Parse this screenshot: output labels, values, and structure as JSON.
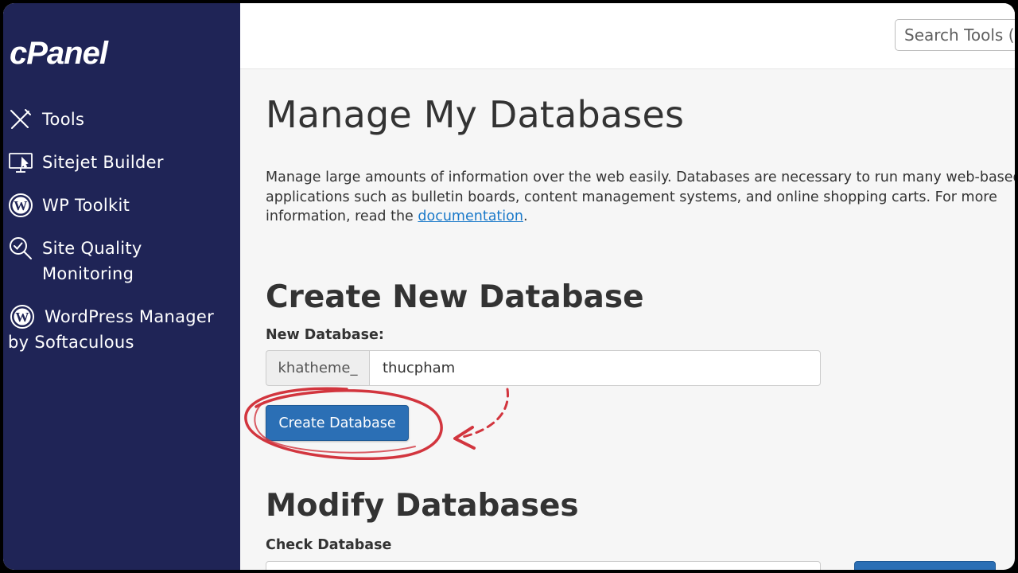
{
  "sidebar": {
    "brand": "cPanel",
    "items": [
      {
        "label": "Tools",
        "icon": "tools-icon"
      },
      {
        "label": "Sitejet Builder",
        "icon": "monitor-icon"
      },
      {
        "label": "WP Toolkit",
        "icon": "wordpress-icon"
      },
      {
        "label": "Site Quality Monitoring",
        "icon": "search-check-icon"
      },
      {
        "label": "WordPress Manager by Softaculous",
        "icon": "wordpress-icon"
      }
    ]
  },
  "topbar": {
    "search_placeholder": "Search Tools ("
  },
  "main": {
    "title": "Manage My Databases",
    "description": "Manage large amounts of information over the web easily. Databases are necessary to run many web-based applications such as bulletin boards, content management systems, and online shopping carts. For more information, read the",
    "description_link": "documentation",
    "description_end": ".",
    "create": {
      "heading": "Create New Database",
      "label": "New Database:",
      "prefix": "khatheme_",
      "value": "thucpham",
      "button": "Create Database"
    },
    "modify": {
      "heading": "Modify Databases",
      "check_label": "Check Database"
    }
  },
  "colors": {
    "sidebar_bg": "#1f2456",
    "primary_button": "#2b6fb5",
    "annotation": "#d2353e",
    "link": "#1a79c9"
  }
}
